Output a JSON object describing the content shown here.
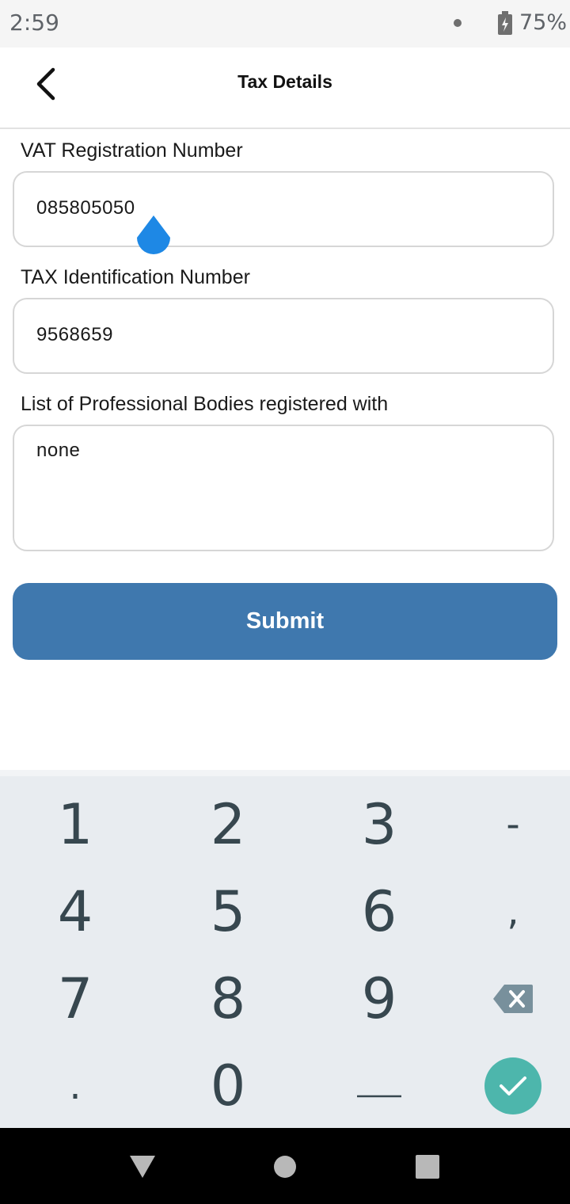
{
  "status_bar": {
    "time": "2:59",
    "battery": "75%",
    "battery_icon": "battery-charging-icon",
    "notification_icon": "dot-icon"
  },
  "header": {
    "title": "Tax Details",
    "back_icon": "chevron-left-icon"
  },
  "form": {
    "vat": {
      "label": "VAT Registration Number",
      "value": "085805050"
    },
    "tax_id": {
      "label": "TAX Identification Number",
      "value": "9568659"
    },
    "professional_bodies": {
      "label": "List of Professional Bodies registered with",
      "value": "none"
    },
    "submit_label": "Submit"
  },
  "keyboard": {
    "row1": [
      "1",
      "2",
      "3",
      "-"
    ],
    "row2": [
      "4",
      "5",
      "6",
      ","
    ],
    "row3": [
      "7",
      "8",
      "9"
    ],
    "row4": [
      ".",
      "0"
    ],
    "backspace_icon": "backspace-icon",
    "space_icon": "space-icon",
    "done_icon": "checkmark-icon"
  },
  "nav_bar": {
    "back_icon": "triangle-back-icon",
    "home_icon": "circle-home-icon",
    "recents_icon": "square-recents-icon"
  },
  "colors": {
    "accent": "#3f78ae",
    "cursor_handle": "#1e88e5",
    "done_key": "#4db6ac"
  }
}
